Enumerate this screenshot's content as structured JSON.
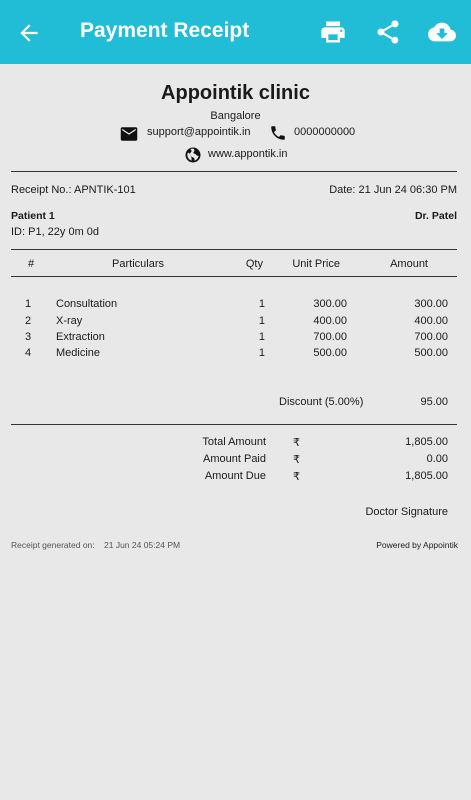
{
  "appbar": {
    "title": "Payment Receipt"
  },
  "clinic": {
    "name": "Appointik clinic",
    "city": "Bangalore",
    "email": "support@appointik.in",
    "phone": "0000000000",
    "website": "www.appontik.in"
  },
  "receipt": {
    "number": "Receipt No.: APNTIK-101",
    "date": "Date: 21 Jun 24  06:30 PM"
  },
  "patient": {
    "name": "Patient 1",
    "details": "ID: P1, 22y  0m  0d",
    "doctor": "Dr. Patel"
  },
  "table": {
    "headers": {
      "index": "#",
      "particulars": "Particulars",
      "qty": "Qty",
      "unit_price": "Unit Price",
      "amount": "Amount"
    },
    "rows": [
      {
        "index": "1",
        "particulars": "Consultation",
        "qty": "1",
        "unit_price": "300.00",
        "amount": "300.00"
      },
      {
        "index": "2",
        "particulars": "X-ray",
        "qty": "1",
        "unit_price": "400.00",
        "amount": "400.00"
      },
      {
        "index": "3",
        "particulars": "Extraction",
        "qty": "1",
        "unit_price": "700.00",
        "amount": "700.00"
      },
      {
        "index": "4",
        "particulars": "Medicine",
        "qty": "1",
        "unit_price": "500.00",
        "amount": "500.00"
      }
    ]
  },
  "discount": {
    "label": "Discount (5.00%)",
    "value": "95.00"
  },
  "totals": [
    {
      "label": "Total Amount",
      "currency": "₹",
      "value": "1,805.00"
    },
    {
      "label": "Amount Paid",
      "currency": "₹",
      "value": "0.00"
    },
    {
      "label": "Amount Due",
      "currency": "₹",
      "value": "1,805.00"
    }
  ],
  "signature": "Doctor Signature",
  "footer": {
    "generated_label": "Receipt generated on:",
    "generated_value": "21 Jun 24  05:24 PM",
    "powered_by": "Powered by Appointik"
  },
  "icons": {
    "back": "arrow-left-icon",
    "print": "printer-icon",
    "share": "share-icon",
    "download": "cloud-download-icon",
    "email": "email-icon",
    "phone": "phone-icon",
    "web": "globe-icon"
  },
  "colors": {
    "appbar": "#21bcd6",
    "background": "#e8e8e8"
  }
}
